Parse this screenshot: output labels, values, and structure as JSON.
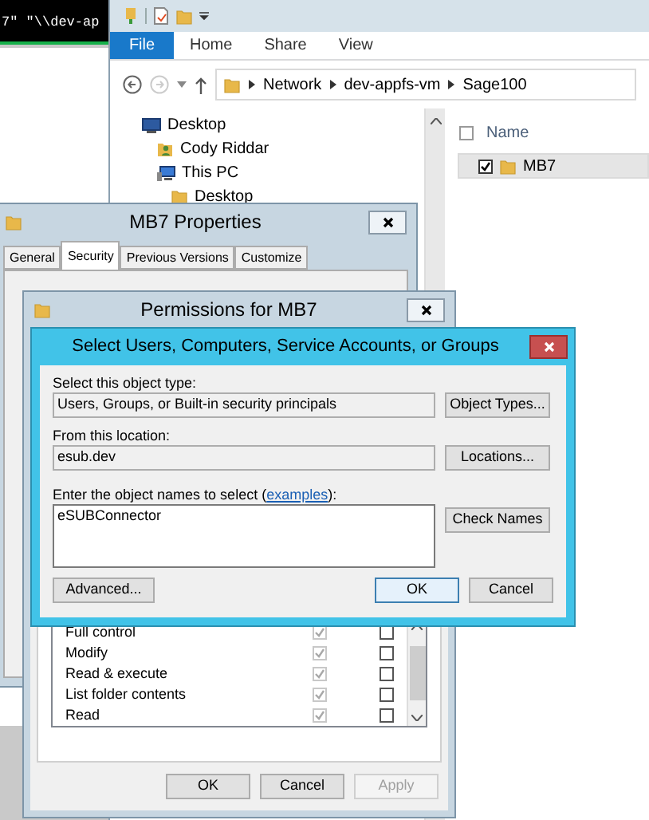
{
  "terminal": {
    "text": "7\" \"\\\\dev-ap"
  },
  "explorer": {
    "ribbon_tabs": [
      {
        "label": "File",
        "selected": true
      },
      {
        "label": "Home",
        "selected": false
      },
      {
        "label": "Share",
        "selected": false
      },
      {
        "label": "View",
        "selected": false
      }
    ],
    "address": [
      "Network",
      "dev-appfs-vm",
      "Sage100"
    ],
    "nav_items": [
      {
        "label": "Desktop",
        "kind": "desktop",
        "children": [
          {
            "label": "Cody Riddar",
            "kind": "user"
          },
          {
            "label": "This PC",
            "kind": "pc",
            "children": [
              {
                "label": "Desktop",
                "kind": "folder"
              }
            ]
          }
        ]
      }
    ],
    "select_all_checked": false,
    "columns": [
      "Name"
    ],
    "files": [
      {
        "name": "MB7",
        "checked": true
      }
    ]
  },
  "properties": {
    "title": "MB7 Properties",
    "tabs": [
      {
        "label": "General",
        "selected": false
      },
      {
        "label": "Security",
        "selected": true
      },
      {
        "label": "Previous Versions",
        "selected": false
      },
      {
        "label": "Customize",
        "selected": false
      }
    ]
  },
  "permissions": {
    "title": "Permissions for MB7",
    "rows": [
      {
        "label": "Full control",
        "allow": true,
        "deny": false
      },
      {
        "label": "Modify",
        "allow": true,
        "deny": false
      },
      {
        "label": "Read & execute",
        "allow": true,
        "deny": false
      },
      {
        "label": "List folder contents",
        "allow": true,
        "deny": false
      },
      {
        "label": "Read",
        "allow": true,
        "deny": false
      }
    ],
    "buttons": [
      {
        "label": "OK",
        "disabled": false
      },
      {
        "label": "Cancel",
        "disabled": false
      },
      {
        "label": "Apply",
        "disabled": true
      }
    ]
  },
  "select_dialog": {
    "title": "Select Users, Computers, Service Accounts, or Groups",
    "object_type_label": "Select this object type:",
    "object_type": "Users, Groups, or Built-in security principals",
    "object_types_button": "Object Types...",
    "location_label": "From this location:",
    "location": "esub.dev",
    "locations_button": "Locations...",
    "names_label_before": "Enter the object names to select (",
    "names_link": "examples",
    "names_label_after": "):",
    "names_value": "eSUBConnector",
    "check_names_button": "Check Names",
    "advanced_button": "Advanced...",
    "ok_button": "OK",
    "cancel_button": "Cancel"
  }
}
